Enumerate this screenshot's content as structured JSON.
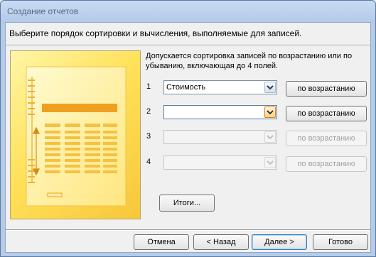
{
  "window": {
    "title": "Создание отчетов"
  },
  "instruction": "Выберите порядок сортировки и вычисления, выполняемые для записей.",
  "description": "Допускается сортировка записей по возрастанию или по убыванию, включающая до 4 полей.",
  "sort_rows": [
    {
      "number": "1",
      "field": "Стоимость",
      "order": "по возрастанию",
      "enabled": true
    },
    {
      "number": "2",
      "field": "",
      "order": "по возрастанию",
      "enabled": true
    },
    {
      "number": "3",
      "field": "",
      "order": "по возрастанию",
      "enabled": false
    },
    {
      "number": "4",
      "field": "",
      "order": "по возрастанию",
      "enabled": false
    }
  ],
  "summary_button": "Итоги...",
  "footer": {
    "cancel": "Отмена",
    "back": "< Назад",
    "next": "Далее >",
    "finish": "Готово"
  },
  "colors": {
    "illustration_light": "#fff6a8",
    "illustration_dark": "#f7c73a",
    "accent_orange": "#e8a020"
  }
}
